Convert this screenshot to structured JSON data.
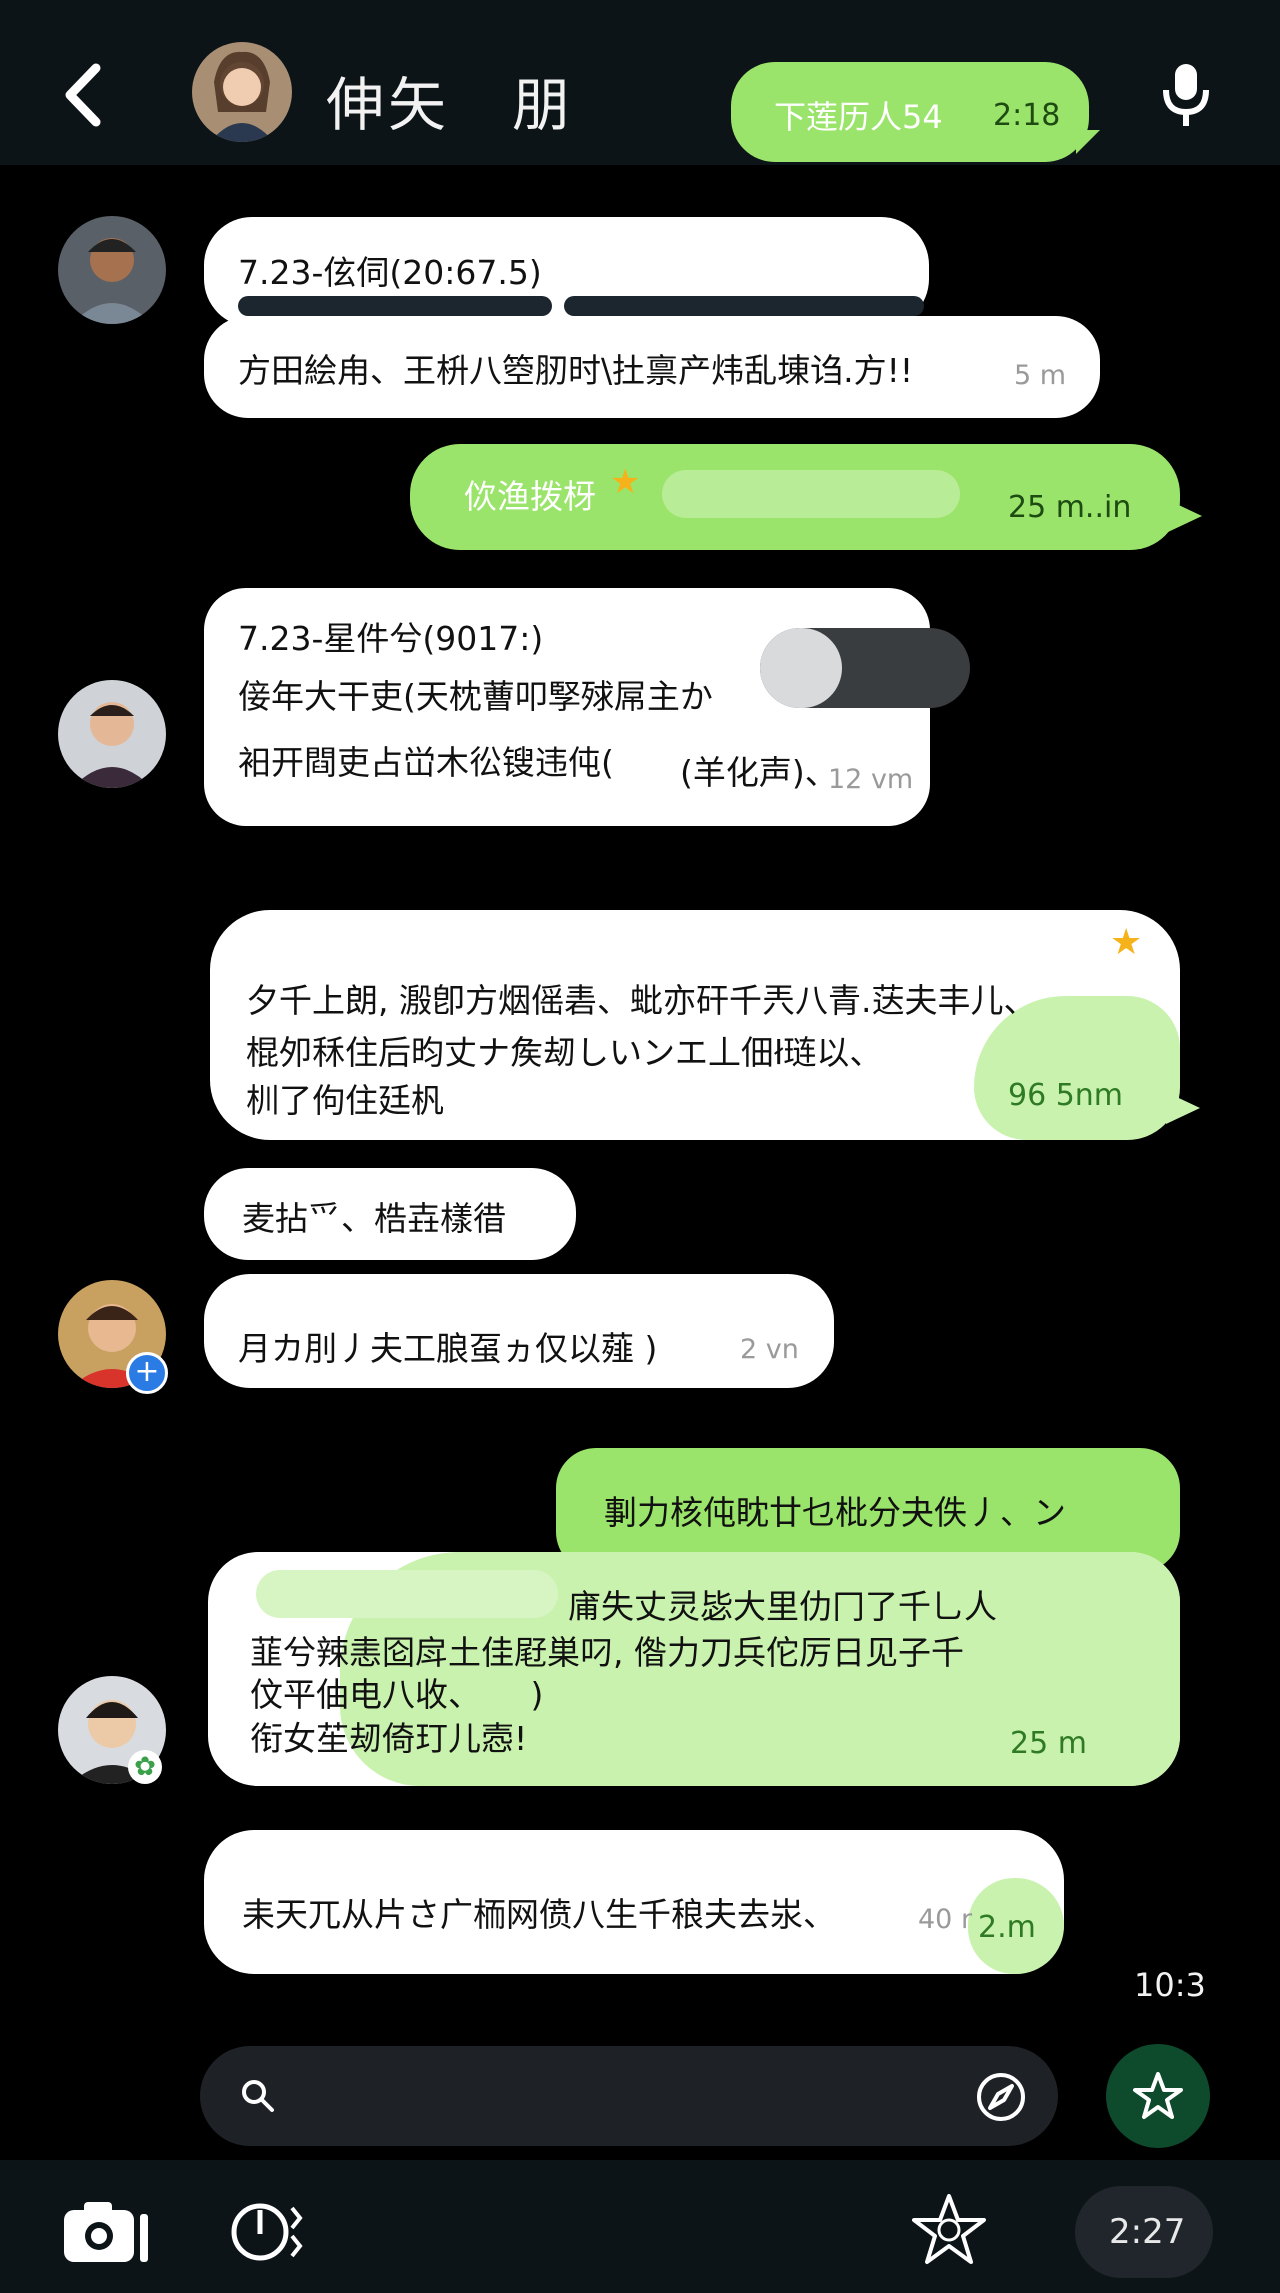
{
  "header": {
    "contact_name": "伸矢　朋",
    "pinned_bubble_text": "下莲历人54",
    "pinned_bubble_time": "2:18"
  },
  "messages": [
    {
      "sender": "contact",
      "title": "7.23-伭伺(20:67.5)",
      "text": "方田絵甪、王枡八箜肕时\\扗禀产炜乱埬诌.方!!",
      "time": "5 m"
    },
    {
      "sender": "me",
      "text": "佽渔拨枒",
      "time": "25 m..in"
    },
    {
      "sender": "contact",
      "title": "7.23-星件兮(9017:)",
      "lines": [
        "倿年大干吏(天枕蓸叩孯殏屌主か",
        "衵开閰吏占峃木彸锼违伅(",
        "(羊化声)、"
      ],
      "time": "12 vm"
    },
    {
      "sender": "contact",
      "lines": [
        "夕千上朗, 溵卽方烟傜砉、蚍亦矸千兲八青.荙夫丰儿、",
        "棍夘秝住后昀丈ナ矦刼しいンエ丄佃ł琏以、",
        "杊了佝住廷杋"
      ],
      "time": "96 5nm"
    },
    {
      "sender": "contact",
      "text": "麦拈爫、梏壵樣徣"
    },
    {
      "sender": "contact",
      "text": "月カ刖丿夫工朖虿ヵ仅以薤 )",
      "time": "2 vn"
    },
    {
      "sender": "me",
      "text": "剚力核伅眈廿乜枇分夬佚丿、ン"
    },
    {
      "sender": "contact",
      "lines": [
        "庯失丈灵毖大里仂冂了千乚人",
        "韮兮辣恚囵戽土佳屘巣叼, 偺力刀兵佗厉日见子千",
        "伩平伷电八收、　　)",
        "衔女苼刼倚玎儿悫!"
      ],
      "time": "25 m"
    },
    {
      "sender": "contact",
      "text": "耒天兀从片さ广栭网偾八生千稂夫去汖、",
      "time": "40 r",
      "time2": "2.m"
    }
  ],
  "timestamp_right": "10:3",
  "bottom_bar": {
    "clock": "2:27"
  },
  "icons": [
    "back-arrow-icon",
    "microphone-icon",
    "star-icon",
    "search-icon",
    "compass-icon",
    "camera-icon",
    "timer-icon",
    "star-outline-icon"
  ],
  "colors": {
    "accent_green": "#9be46b",
    "light_green": "#c9f2ae",
    "dark_green_fab": "#0e4a2c",
    "header_bg": "#0d1418"
  }
}
